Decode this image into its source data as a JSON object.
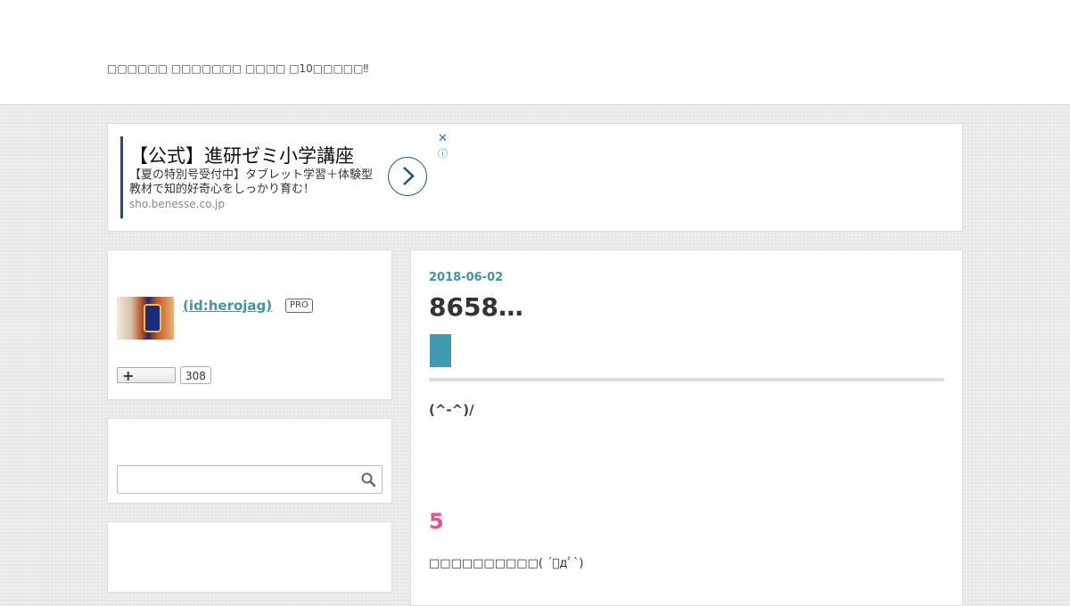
{
  "header": {
    "blog_description": "□□□□□□ □□□□□□□ □□□□ □10□□□□□‼"
  },
  "ad": {
    "title": "【公式】進研ゼミ小学講座",
    "text": "【夏の特別号受付中】タブレット学習＋体験型教材で知的好奇心をしっかり育む！",
    "url": "sho.benesse.co.jp",
    "close_glyph": "✕",
    "info_glyph": "ⓘ",
    "arrow_icon": "chevron-right-icon",
    "accent_color": "#1a4f8c"
  },
  "profile": {
    "name": " (id:herojag)",
    "badge": "PRO",
    "follow_icon": "plus-icon",
    "follower_count": "308"
  },
  "search": {
    "placeholder": "",
    "icon": "search-icon"
  },
  "entry": {
    "date": "2018-06-02",
    "title": "8658…",
    "face": "(^-^)/",
    "heading": "5",
    "tail_text": "□□□□□□□□□□( ´ﾟдﾟ`)",
    "accent_color": "#3f94a6",
    "heading_color": "#e84f8e"
  }
}
